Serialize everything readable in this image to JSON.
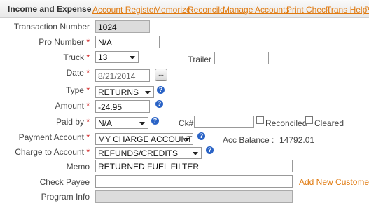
{
  "header": {
    "title": "Income and Expense",
    "tabs": [
      "Account Register",
      "Memorize",
      "Reconcile",
      "Manage Accounts",
      "Print Check",
      "Trans Help",
      "P"
    ]
  },
  "form": {
    "transaction_number": {
      "label": "Transaction Number",
      "value": "1024"
    },
    "pro_number": {
      "label": "Pro Number",
      "value": "N/A"
    },
    "truck": {
      "label": "Truck",
      "value": "13"
    },
    "trailer": {
      "label": "Trailer",
      "value": ""
    },
    "date": {
      "label": "Date",
      "value": "8/21/2014",
      "button": "..."
    },
    "type": {
      "label": "Type",
      "value": "RETURNS"
    },
    "amount": {
      "label": "Amount",
      "value": "-24.95"
    },
    "paid_by": {
      "label": "Paid by",
      "value": "N/A"
    },
    "check_number": {
      "label": "Ck#",
      "value": ""
    },
    "reconciled": {
      "label": "Reconciled"
    },
    "cleared": {
      "label": "Cleared"
    },
    "payment_account": {
      "label": "Payment Account",
      "value": "MY CHARGE ACCOUNT"
    },
    "acc_balance": {
      "label": "Acc Balance :",
      "value": "14792.01"
    },
    "charge_to_account": {
      "label": "Charge to Account",
      "value": "REFUNDS/CREDITS"
    },
    "memo": {
      "label": "Memo",
      "value": "RETURNED FUEL FILTER"
    },
    "check_payee": {
      "label": "Check Payee",
      "value": ""
    },
    "add_new_customer": "Add New Customer",
    "program_info": {
      "label": "Program Info",
      "value": ""
    },
    "required_marker": "*",
    "help_glyph": "?"
  },
  "colors": {
    "link": "#e07a10",
    "help_icon": "#2a63c6"
  }
}
